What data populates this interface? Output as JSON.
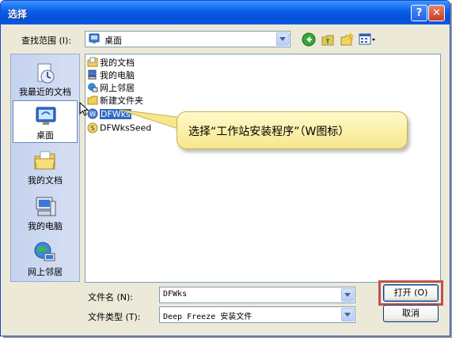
{
  "window": {
    "title": "选择",
    "help_symbol": "?",
    "close_symbol": "✕"
  },
  "lookin": {
    "label": "查找范围 (I):",
    "value": "桌面"
  },
  "toolbar": {
    "icons": [
      "back-icon",
      "up-folder-icon",
      "new-folder-icon",
      "view-menu-icon"
    ]
  },
  "places": [
    {
      "label": "我最近的文档",
      "icon": "recent-docs-icon"
    },
    {
      "label": "桌面",
      "icon": "desktop-icon",
      "selected": true
    },
    {
      "label": "我的文档",
      "icon": "my-documents-icon"
    },
    {
      "label": "我的电脑",
      "icon": "my-computer-icon"
    },
    {
      "label": "网上邻居",
      "icon": "network-places-icon"
    }
  ],
  "files": [
    {
      "name": "我的文档",
      "icon": "my-documents-icon"
    },
    {
      "name": "我的电脑",
      "icon": "my-computer-icon"
    },
    {
      "name": "网上邻居",
      "icon": "network-places-icon"
    },
    {
      "name": "新建文件夹",
      "icon": "folder-icon"
    },
    {
      "name": "DFWks",
      "icon": "dfwks-app-icon",
      "selected": true
    },
    {
      "name": "DFWksSeed",
      "icon": "dfwksseed-app-icon"
    }
  ],
  "filename": {
    "label": "文件名 (N):",
    "value": "DFWks"
  },
  "filetype": {
    "label": "文件类型 (T):",
    "value": "Deep Freeze 安装文件"
  },
  "buttons": {
    "open": "打开 (O)",
    "cancel": "取消"
  },
  "callout": {
    "text": "选择“工作站安装程序”（W图标）"
  },
  "colors": {
    "titlebar": "#0a5ee8",
    "selection": "#316ac5",
    "callout_fill": "#f6e78d",
    "highlight_border": "#c0504d"
  }
}
